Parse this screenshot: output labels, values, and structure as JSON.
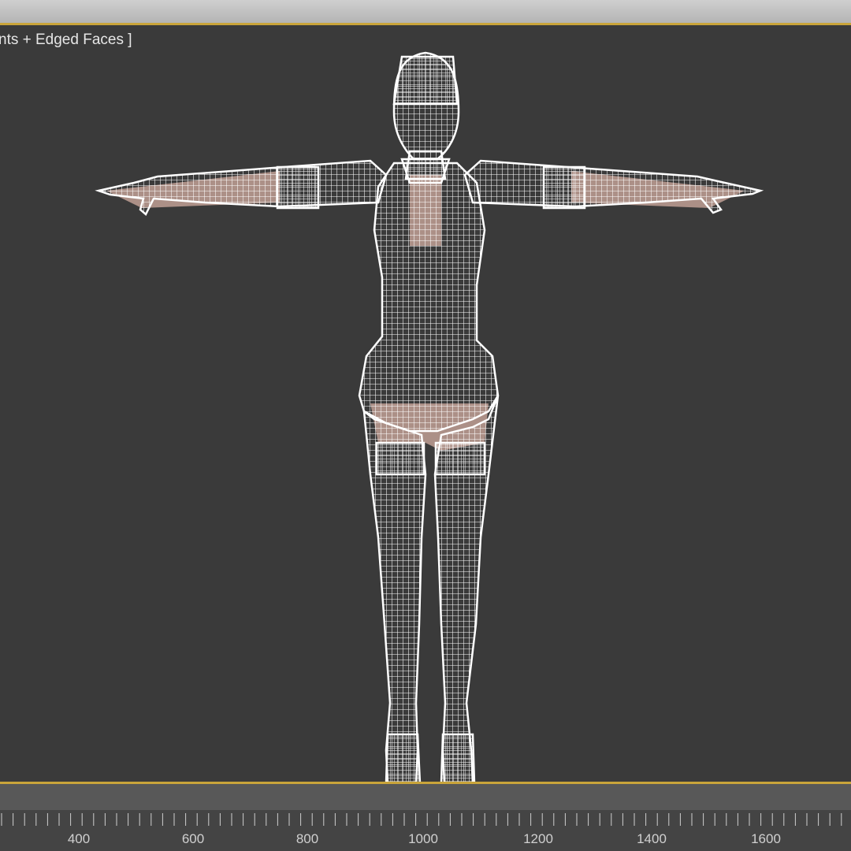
{
  "viewport": {
    "label": "nts + Edged Faces ]",
    "border_color": "#c9a43a",
    "background_color": "#3a3a3a",
    "wire_color": "#ffffff"
  },
  "ruler": {
    "labels": [
      "400",
      "600",
      "800",
      "1000",
      "1200",
      "1400",
      "1600"
    ]
  }
}
